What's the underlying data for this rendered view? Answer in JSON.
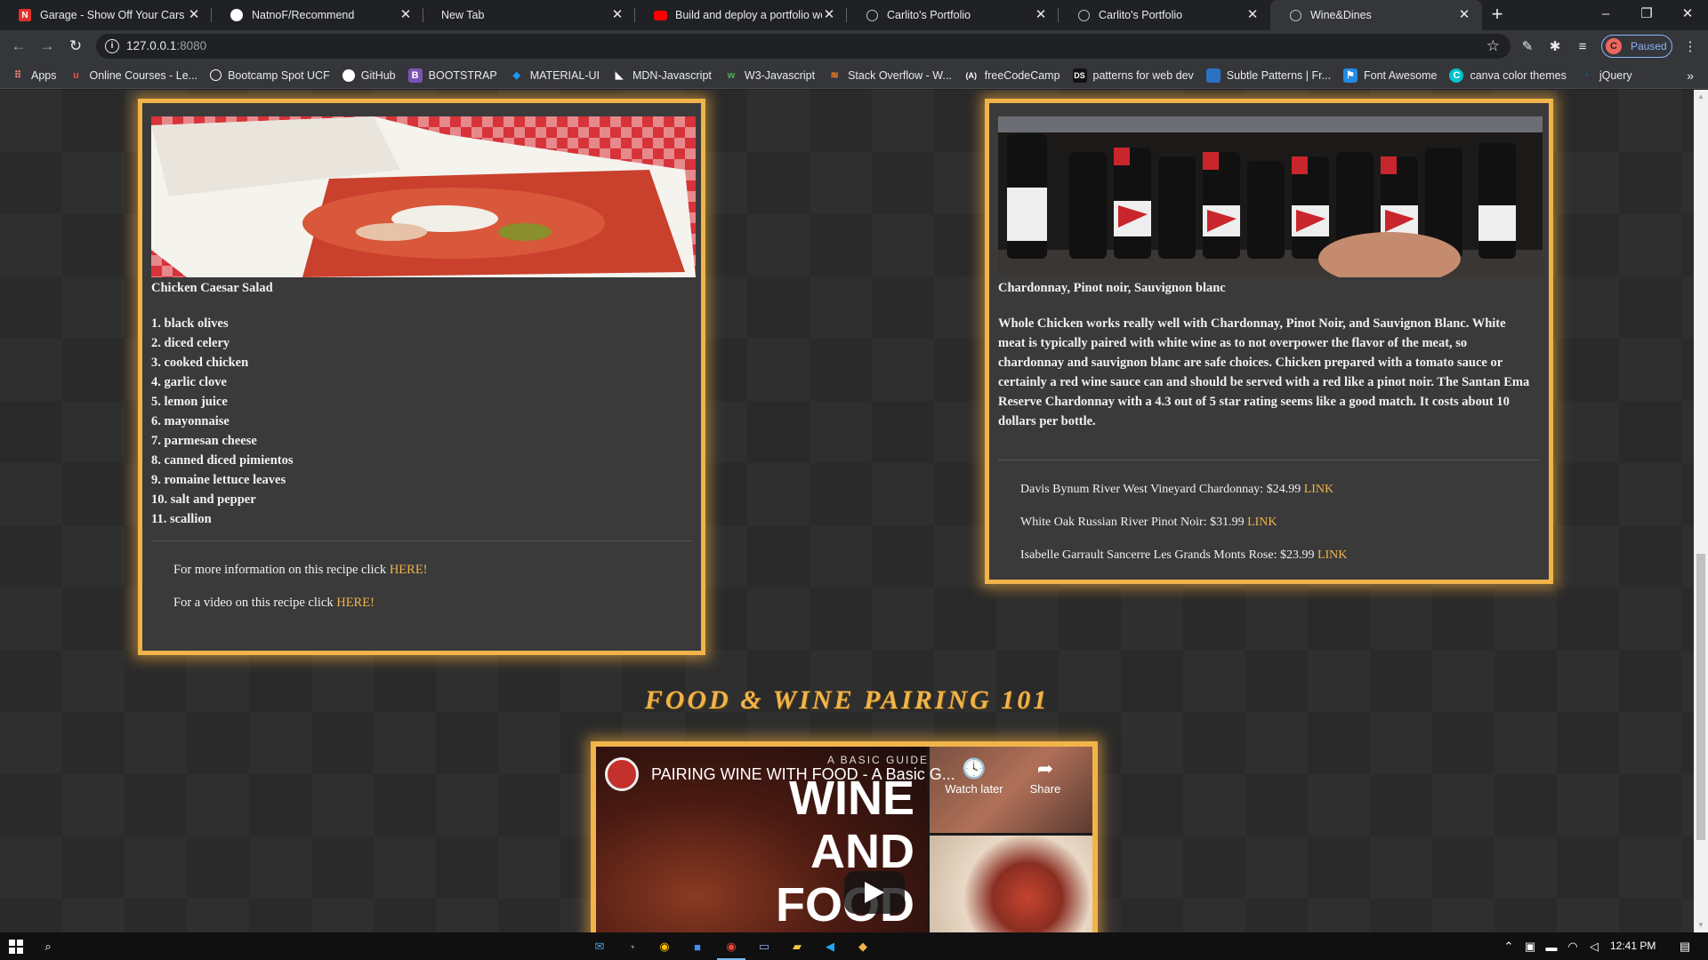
{
  "browser": {
    "tabs": [
      {
        "title": "Garage - Show Off Your Cars | N",
        "icon": "netlify-n-icon",
        "active": false
      },
      {
        "title": "NatnoF/Recommend",
        "icon": "github-icon",
        "active": false
      },
      {
        "title": "New Tab",
        "icon": "",
        "active": false
      },
      {
        "title": "Build and deploy a portfolio web",
        "icon": "youtube-icon",
        "active": false
      },
      {
        "title": "Carlito's Portfolio",
        "icon": "globe-icon",
        "active": false
      },
      {
        "title": "Carlito's Portfolio",
        "icon": "globe-icon",
        "active": false
      },
      {
        "title": "Wine&Dines",
        "icon": "globe-icon",
        "active": true
      }
    ],
    "url_host": "127.0.0.1",
    "url_port": ":8080",
    "profile_initial": "C",
    "profile_status": "Paused",
    "bookmarks": [
      {
        "label": "Apps",
        "icon": "apps-grid-icon"
      },
      {
        "label": "Online Courses - Le...",
        "icon": "udemy-icon"
      },
      {
        "label": "Bootcamp Spot UCF",
        "icon": "bootcamp-icon"
      },
      {
        "label": "GitHub",
        "icon": "github-icon"
      },
      {
        "label": "BOOTSTRAP",
        "icon": "bootstrap-icon"
      },
      {
        "label": "MATERIAL-UI",
        "icon": "material-ui-icon"
      },
      {
        "label": "MDN-Javascript",
        "icon": "mdn-icon"
      },
      {
        "label": "W3-Javascript",
        "icon": "w3-icon"
      },
      {
        "label": "Stack Overflow - W...",
        "icon": "stackoverflow-icon"
      },
      {
        "label": "freeCodeCamp",
        "icon": "freecodecamp-icon"
      },
      {
        "label": "patterns for web dev",
        "icon": "ds-icon"
      },
      {
        "label": "Subtle Patterns | Fr...",
        "icon": "subtle-patterns-icon"
      },
      {
        "label": "Font Awesome",
        "icon": "font-awesome-icon"
      },
      {
        "label": "canva color themes",
        "icon": "canva-icon"
      },
      {
        "label": "jQuery",
        "icon": "jquery-icon"
      }
    ]
  },
  "recipe": {
    "image_alt": "open cookbook with pasta dish on checkered tablecloth",
    "title": "Chicken Caesar Salad",
    "ingredients": [
      "1. black olives",
      "2. diced celery",
      "3. cooked chicken",
      "4. garlic clove",
      "5. lemon juice",
      "6. mayonnaise",
      "7. parmesan cheese",
      "8. canned diced pimientos",
      "9. romaine lettuce leaves",
      "10. salt and pepper",
      "11. scallion"
    ],
    "more_info_text": "For more information on this recipe click ",
    "more_info_link": "HERE!",
    "video_text": "For a video on this recipe click ",
    "video_link": "HERE!"
  },
  "wine": {
    "image_alt": "wine bottles on a store shelf",
    "title": "Chardonnay, Pinot noir, Sauvignon blanc",
    "description": "Whole Chicken works really well with Chardonnay, Pinot Noir, and Sauvignon Blanc. White meat is typically paired with white wine as to not overpower the flavor of the meat, so chardonnay and sauvignon blanc are safe choices. Chicken prepared with a tomato sauce or certainly a red wine sauce can and should be served with a red like a pinot noir. The Santan Ema Reserve Chardonnay with a 4.3 out of 5 star rating seems like a good match. It costs about 10 dollars per bottle.",
    "recommendations": [
      {
        "text": "Davis Bynum River West Vineyard Chardonnay: $24.99 ",
        "link": "LINK"
      },
      {
        "text": "White Oak Russian River Pinot Noir: $31.99 ",
        "link": "LINK"
      },
      {
        "text": "Isabelle Garrault Sancerre Les Grands Monts Rose: $23.99 ",
        "link": "LINK"
      }
    ]
  },
  "section_heading": "Food & Wine Pairing 101",
  "video": {
    "title": "PAIRING WINE WITH FOOD - A Basic G...",
    "overlay_small": "A BASIC GUIDE",
    "overlay_big": [
      "WINE",
      "AND",
      "FOOD"
    ],
    "watch_later": "Watch later",
    "share": "Share"
  },
  "taskbar": {
    "time": "12:41 PM"
  },
  "colors": {
    "accent": "#f0b44a",
    "card_bg": "#3a3a3b",
    "page_bg": "#2f2f2f"
  }
}
